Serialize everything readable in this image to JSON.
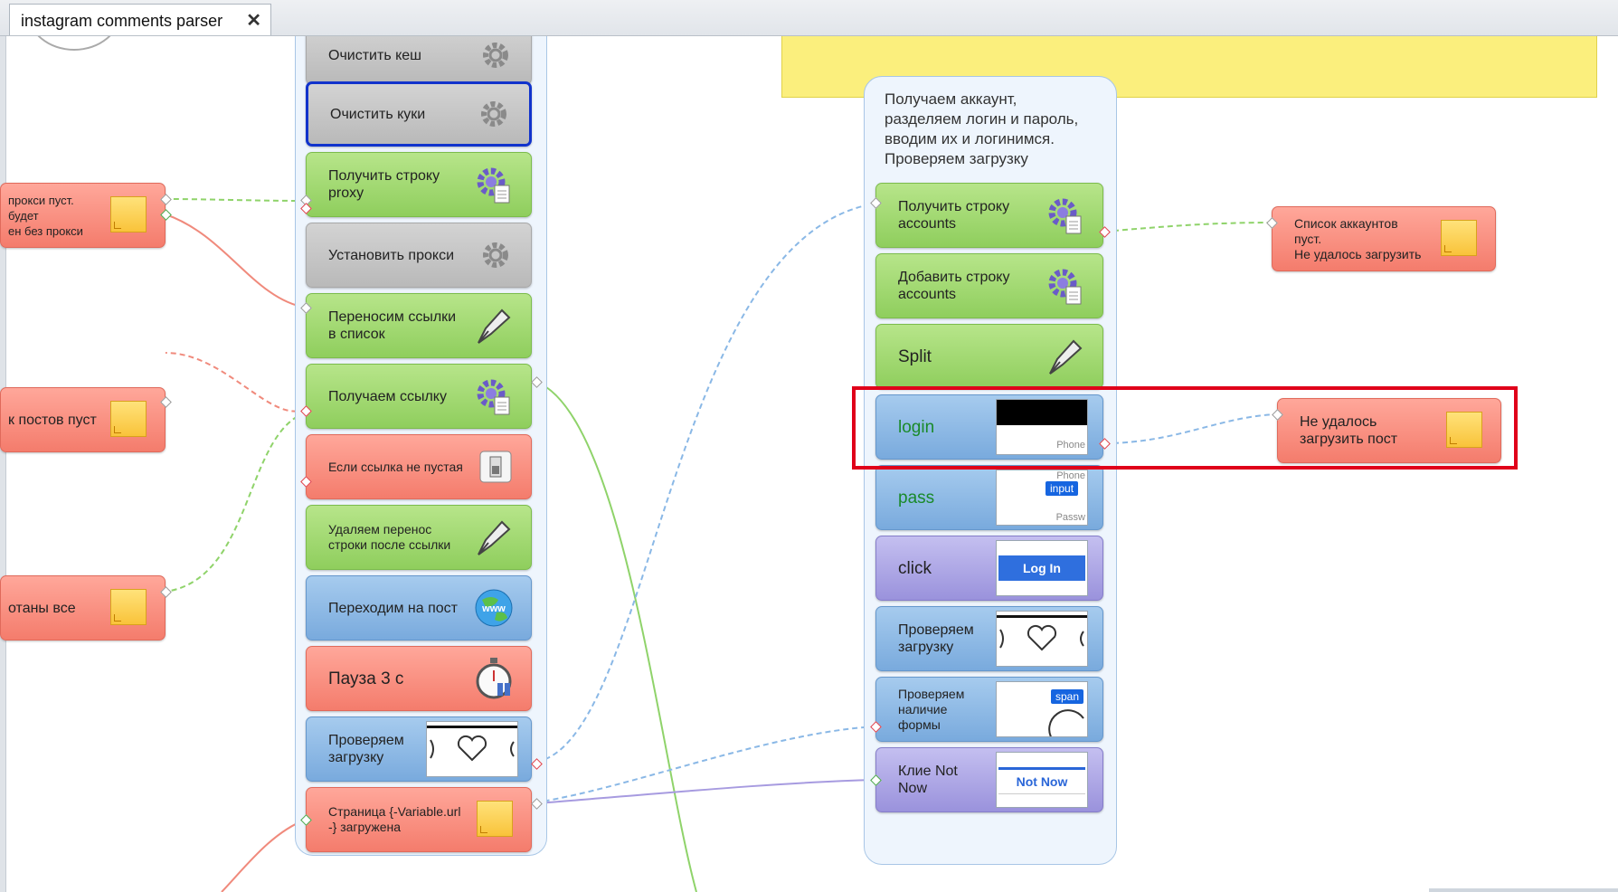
{
  "tab": {
    "title": "instagram comments parser",
    "close": "✕"
  },
  "colors": {
    "highlight": "#e0001a",
    "note": "#f47c6c",
    "action": "#8fce5d",
    "browser": "#79aadd",
    "disabled": "#b9b9b9"
  },
  "left_notes": [
    {
      "text": "прокси пуст.\n будет\nен без прокси"
    },
    {
      "text": "к постов пуст"
    },
    {
      "text": "отаны все"
    }
  ],
  "column1": [
    {
      "label": "Очистить кеш",
      "icon": "gear-icon"
    },
    {
      "label": "Очистить куки",
      "icon": "gear-icon"
    },
    {
      "label": "Получить строку\nproxy",
      "icon": "list-gear-icon"
    },
    {
      "label": "Установить прокси",
      "icon": "gear-icon"
    },
    {
      "label": "Переносим ссылки\nв список",
      "icon": "pen-icon"
    },
    {
      "label": "Получаем ссылку",
      "icon": "list-gear-icon"
    },
    {
      "label": "Если ссылка не пустая",
      "icon": "switch-icon"
    },
    {
      "label": "Удаляем перенос\nстроки после ссылки",
      "icon": "pen-icon"
    },
    {
      "label": "Переходим на пост",
      "icon": "globe-icon"
    },
    {
      "label": "Пауза 3 с",
      "icon": "stopwatch-icon"
    },
    {
      "label": "Проверяем\nзагрузку",
      "icon": "heart-thumb"
    },
    {
      "label": "Страница {-Variable.url\n-} загружена",
      "icon": "note-icon"
    }
  ],
  "group2": {
    "title": "Получаем аккаунт,\nразделяем логин и пароль,\nвводим их и логинимся.\nПроверяем загрузку",
    "nodes": [
      {
        "label": "Получить строку\naccounts",
        "icon": "list-gear-icon"
      },
      {
        "label": "Добавить строку\naccounts",
        "icon": "list-gear-icon"
      },
      {
        "label": "Split",
        "icon": "pen-icon"
      },
      {
        "label": "login",
        "thumb_text": "Phone"
      },
      {
        "label": "pass",
        "thumb_text": "Phone",
        "thumb_tag": "input",
        "thumb_text2": "Passw"
      },
      {
        "label": "click",
        "thumb_btn": "Log In"
      },
      {
        "label": "Проверяем\nзагрузку",
        "icon": "heart-thumb"
      },
      {
        "label": "Проверяем\nналичие\nформы",
        "thumb_tag": "span"
      },
      {
        "label": "Клие Not\nNow",
        "thumb_link": "Not Now"
      }
    ]
  },
  "right_notes": [
    {
      "text": "Список аккаунтов\nпуст.\nНе удалось загрузить"
    },
    {
      "text": "Не удалось\nзагрузить пост"
    }
  ]
}
